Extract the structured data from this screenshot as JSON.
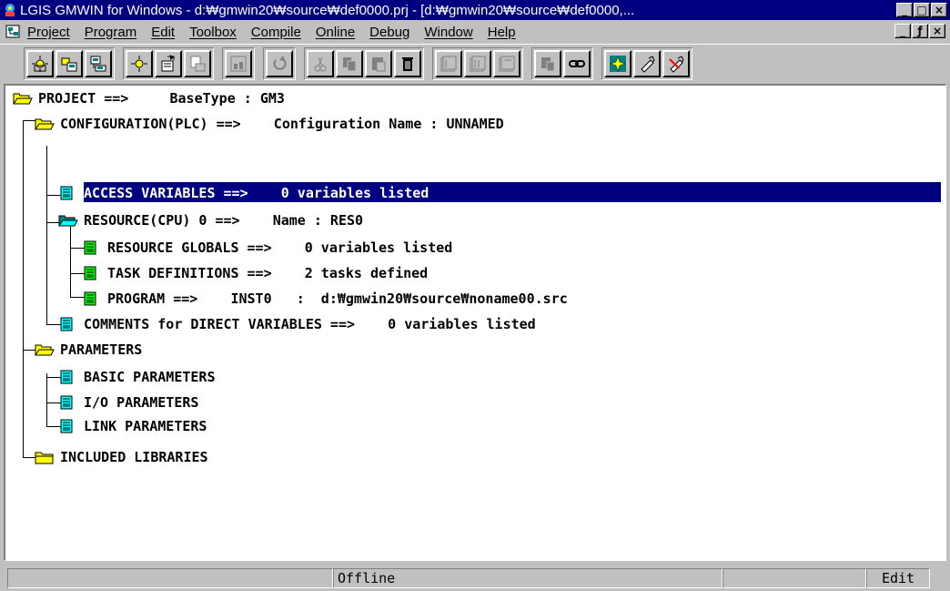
{
  "window": {
    "title": "LGIS GMWIN for Windows - d:₩gmwin20₩source₩def0000.prj - [d:₩gmwin20₩source₩def0000,...",
    "minimize_glyph": "_",
    "maximize_glyph": "□",
    "close_glyph": "×",
    "mdi_restore_glyph": "ƒ"
  },
  "menubar": {
    "items": [
      "Project",
      "Program",
      "Edit",
      "Toolbox",
      "Compile",
      "Online",
      "Debug",
      "Window",
      "Help"
    ]
  },
  "toolbar": {
    "groups": [
      [
        "new-project-icon",
        "open-project-icon",
        "save-project-icon"
      ],
      [
        "new-program-icon",
        "open-program-icon",
        "save-program-icon"
      ],
      [
        "variables-icon"
      ],
      [
        "undo-icon"
      ],
      [
        "cut-icon",
        "copy-icon",
        "paste-icon",
        "delete-icon"
      ],
      [
        "compile-icon",
        "compile-all-icon",
        "make-icon"
      ],
      [
        "download-icon",
        "link-icon"
      ],
      [
        "monitor-icon",
        "connect-icon",
        "disconnect-icon"
      ]
    ]
  },
  "tree": {
    "project": "PROJECT ==>     BaseType : GM3",
    "configuration": "CONFIGURATION(PLC) ==>    Configuration Name : UNNAMED",
    "access_variables": "ACCESS VARIABLES ==>    0 variables listed",
    "resource": "RESOURCE(CPU) 0 ==>    Name : RES0",
    "resource_globals": "RESOURCE GLOBALS ==>    0 variables listed",
    "task_definitions": "TASK DEFINITIONS ==>    2 tasks defined",
    "program": "PROGRAM ==>    INST0   :  d:₩gmwin20₩source₩noname00.src",
    "comments": "COMMENTS for DIRECT VARIABLES ==>    0 variables listed",
    "parameters": "PARAMETERS",
    "basic_parameters": "BASIC PARAMETERS",
    "io_parameters": "I/O PARAMETERS",
    "link_parameters": "LINK PARAMETERS",
    "included_libraries": "INCLUDED LIBRARIES"
  },
  "statusbar": {
    "panel1": "",
    "mode": "Offline",
    "panel3": "",
    "state": "Edit"
  },
  "colors": {
    "title_bar": "#000080",
    "selection": "#000080",
    "folder": "#ffff00",
    "doc_cyan": "#00ffff",
    "doc_green": "#00ff00"
  }
}
